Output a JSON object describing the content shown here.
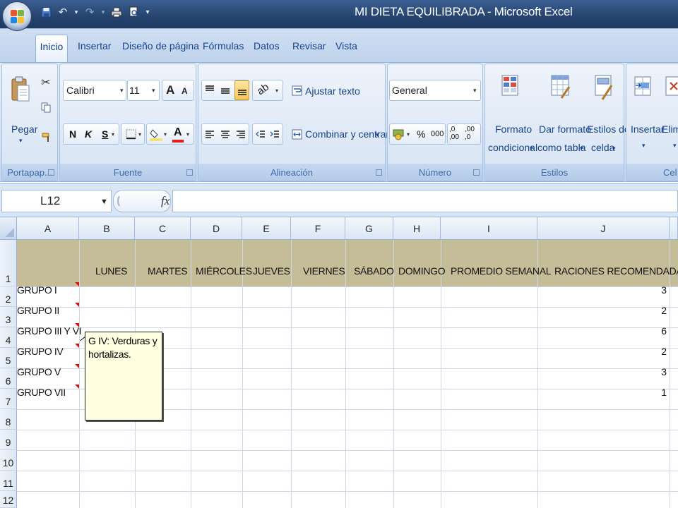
{
  "window": {
    "title": "MI DIETA EQUILIBRADA - Microsoft Excel"
  },
  "ribbon_tabs": [
    "Inicio",
    "Insertar",
    "Diseño de página",
    "Fórmulas",
    "Datos",
    "Revisar",
    "Vista"
  ],
  "ribbon": {
    "clipboard": {
      "paste_label": "Pegar",
      "group_label": "Portapap..."
    },
    "font": {
      "font_name": "Calibri",
      "font_size": "11",
      "bold": "N",
      "italic": "K",
      "underline": "S",
      "grow_font": "A",
      "shrink_font": "A",
      "font_color": "A",
      "group_label": "Fuente"
    },
    "alignment": {
      "wrap_text": "Ajustar texto",
      "merge_center": "Combinar y centrar",
      "group_label": "Alineación"
    },
    "number": {
      "format": "General",
      "percent": "%",
      "thousands": "000",
      "inc_decimals": ",0 ,00",
      "dec_decimals": ",00 ,0",
      "group_label": "Número"
    },
    "styles": {
      "conditional_line1": "Formato",
      "conditional_line2": "condicional",
      "table_line1": "Dar formato",
      "table_line2": "como tabla",
      "cell_styles_line1": "Estilos de",
      "cell_styles_line2": "celda",
      "group_label": "Estilos"
    },
    "cells": {
      "insert": "Insertar",
      "delete": "Elimi",
      "group_label": "Cel"
    }
  },
  "formula_bar": {
    "name_box": "L12",
    "fx": "fx",
    "formula": ""
  },
  "columns": [
    "A",
    "B",
    "C",
    "D",
    "E",
    "F",
    "G",
    "H",
    "I",
    "J"
  ],
  "rows": [
    "1",
    "2",
    "3",
    "4",
    "5",
    "6",
    "7",
    "8",
    "9",
    "10",
    "11",
    "12"
  ],
  "header_row": [
    "LUNES",
    "MARTES",
    "MIÉRCOLES",
    "JUEVES",
    "VIERNES",
    "SÁBADO",
    "DOMINGO",
    "PROMEDIO SEMANAL",
    "RACIONES RECOMENDADAS"
  ],
  "data_rows": [
    {
      "group": "GRUPO I",
      "recommended": "3"
    },
    {
      "group": "GRUPO II",
      "recommended": "2"
    },
    {
      "group": "GRUPO III Y VI",
      "recommended": "6"
    },
    {
      "group": "GRUPO IV",
      "recommended": "2"
    },
    {
      "group": "GRUPO V",
      "recommended": "3"
    },
    {
      "group": "GRUPO VII",
      "recommended": "1"
    }
  ],
  "comment": {
    "line1": "G IV: Verduras y",
    "line2": "hortalizas."
  },
  "colors": {
    "header_fill": "#c4bd97",
    "comment_fill": "#ffffe1",
    "comment_marker": "#d31414",
    "ribbon_text": "#15428b"
  }
}
